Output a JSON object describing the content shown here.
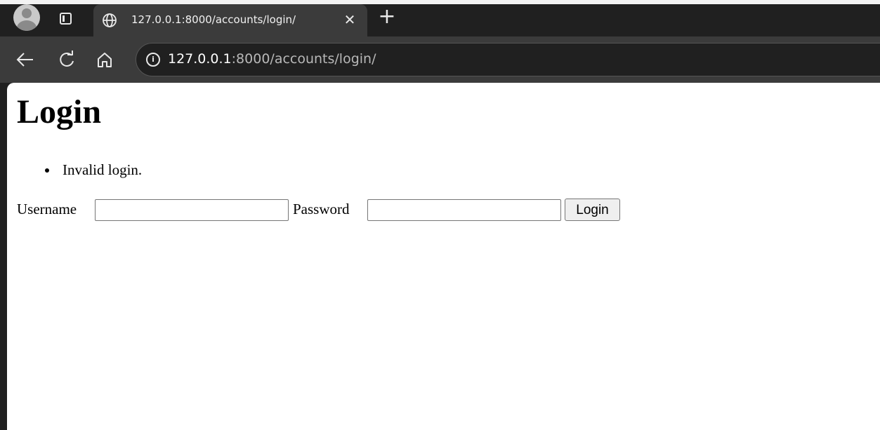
{
  "browser": {
    "tab": {
      "title": "127.0.0.1:8000/accounts/login/",
      "close_glyph": "✕"
    },
    "new_tab_glyph": "+",
    "address_bar": {
      "host": "127.0.0.1",
      "rest": ":8000/accounts/login/"
    },
    "icons": {
      "avatar": "profile-avatar-icon",
      "tab_actions": "tab-actions-icon",
      "tab_site": "globe-icon",
      "back": "back-arrow-icon",
      "reload": "reload-icon",
      "home": "home-icon",
      "site_info": "info-icon"
    }
  },
  "page": {
    "title": "Login",
    "errors": [
      "Invalid login."
    ],
    "form": {
      "username_label": "Username",
      "username_value": "",
      "password_label": "Password",
      "password_value": "",
      "submit_label": "Login"
    }
  }
}
